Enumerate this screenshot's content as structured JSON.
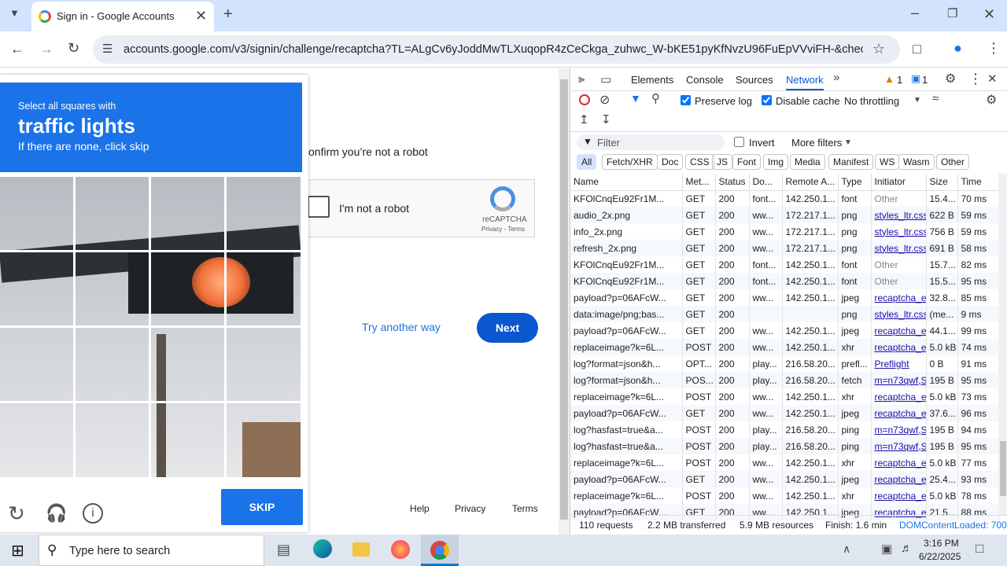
{
  "browser": {
    "tab_title": "Sign in - Google Accounts",
    "url": "accounts.google.com/v3/signin/challenge/recaptcha?TL=ALgCv6yJoddMwTLXuqopR4zCeCkga_zuhwc_W-bKE51pyKfNvzU96FuEpVVviFH-&checkConn..."
  },
  "page": {
    "confirm_text": "onfirm you’re not a robot",
    "not_robot_label": "I'm not a robot",
    "recaptcha_label": "reCAPTCHA",
    "recaptcha_links": "Privacy - Terms",
    "try_another": "Try another way",
    "next": "Next",
    "footer": {
      "help": "Help",
      "privacy": "Privacy",
      "terms": "Terms"
    }
  },
  "captcha": {
    "select_text": "Select all squares with",
    "target": "traffic lights",
    "hint": "If there are none, click skip",
    "skip": "SKIP"
  },
  "devtools": {
    "tabs": [
      "Elements",
      "Console",
      "Sources",
      "Network"
    ],
    "warnings": "1",
    "messages": "1",
    "preserve_log": "Preserve log",
    "disable_cache": "Disable cache",
    "throttling": "No throttling",
    "filter_placeholder": "Filter",
    "invert": "Invert",
    "more_filters": "More filters",
    "type_filters": [
      "All",
      "Fetch/XHR",
      "Doc",
      "CSS",
      "JS",
      "Font",
      "Img",
      "Media",
      "Manifest",
      "WS",
      "Wasm",
      "Other"
    ],
    "columns": [
      "Name",
      "Met...",
      "Status",
      "Do...",
      "Remote A...",
      "Type",
      "Initiator",
      "Size",
      "Time"
    ],
    "rows": [
      [
        "KFOlCnqEu92Fr1M...",
        "GET",
        "200",
        "font...",
        "142.250.1...",
        "font",
        "Other",
        "15.4...",
        "70 ms"
      ],
      [
        "audio_2x.png",
        "GET",
        "200",
        "ww...",
        "172.217.1...",
        "png",
        "styles_ltr.css",
        "622 B",
        "59 ms"
      ],
      [
        "info_2x.png",
        "GET",
        "200",
        "ww...",
        "172.217.1...",
        "png",
        "styles_ltr.css",
        "756 B",
        "59 ms"
      ],
      [
        "refresh_2x.png",
        "GET",
        "200",
        "ww...",
        "172.217.1...",
        "png",
        "styles_ltr.css",
        "691 B",
        "58 ms"
      ],
      [
        "KFOlCnqEu92Fr1M...",
        "GET",
        "200",
        "font...",
        "142.250.1...",
        "font",
        "Other",
        "15.7...",
        "82 ms"
      ],
      [
        "KFOlCnqEu92Fr1M...",
        "GET",
        "200",
        "font...",
        "142.250.1...",
        "font",
        "Other",
        "15.5...",
        "95 ms"
      ],
      [
        "payload?p=06AFcW...",
        "GET",
        "200",
        "ww...",
        "142.250.1...",
        "jpeg",
        "recaptcha_e",
        "32.8...",
        "85 ms"
      ],
      [
        "data:image/png;bas...",
        "GET",
        "200",
        "",
        "",
        "png",
        "styles_ltr.css",
        "(me...",
        "9 ms"
      ],
      [
        "payload?p=06AFcW...",
        "GET",
        "200",
        "ww...",
        "142.250.1...",
        "jpeg",
        "recaptcha_e",
        "44.1...",
        "99 ms"
      ],
      [
        "replaceimage?k=6L...",
        "POST",
        "200",
        "ww...",
        "142.250.1...",
        "xhr",
        "recaptcha_e",
        "5.0 kB",
        "74 ms"
      ],
      [
        "log?format=json&h...",
        "OPT...",
        "200",
        "play...",
        "216.58.20...",
        "prefl...",
        "Preflight",
        "0 B",
        "91 ms"
      ],
      [
        "log?format=json&h...",
        "POS...",
        "200",
        "play...",
        "216.58.20...",
        "fetch",
        "m=n73qwf,S",
        "195 B",
        "95 ms"
      ],
      [
        "replaceimage?k=6L...",
        "POST",
        "200",
        "ww...",
        "142.250.1...",
        "xhr",
        "recaptcha_e",
        "5.0 kB",
        "73 ms"
      ],
      [
        "payload?p=06AFcW...",
        "GET",
        "200",
        "ww...",
        "142.250.1...",
        "jpeg",
        "recaptcha_e",
        "37.6...",
        "96 ms"
      ],
      [
        "log?hasfast=true&a...",
        "POST",
        "200",
        "play...",
        "216.58.20...",
        "ping",
        "m=n73qwf,S",
        "195 B",
        "94 ms"
      ],
      [
        "log?hasfast=true&a...",
        "POST",
        "200",
        "play...",
        "216.58.20...",
        "ping",
        "m=n73qwf,S",
        "195 B",
        "95 ms"
      ],
      [
        "replaceimage?k=6L...",
        "POST",
        "200",
        "ww...",
        "142.250.1...",
        "xhr",
        "recaptcha_e",
        "5.0 kB",
        "77 ms"
      ],
      [
        "payload?p=06AFcW...",
        "GET",
        "200",
        "ww...",
        "142.250.1...",
        "jpeg",
        "recaptcha_e",
        "25.4...",
        "93 ms"
      ],
      [
        "replaceimage?k=6L...",
        "POST",
        "200",
        "ww...",
        "142.250.1...",
        "xhr",
        "recaptcha_e",
        "5.0 kB",
        "78 ms"
      ],
      [
        "payload?p=06AFcW...",
        "GET",
        "200",
        "ww...",
        "142.250.1...",
        "jpeg",
        "recaptcha_e",
        "21.5...",
        "88 ms"
      ]
    ],
    "status": {
      "requests": "110 requests",
      "transferred": "2.2 MB transferred",
      "resources": "5.9 MB resources",
      "finish": "Finish: 1.6 min",
      "dcl": "DOMContentLoaded: 700"
    }
  },
  "taskbar": {
    "search_placeholder": "Type here to search",
    "time": "3:16 PM",
    "date": "6/22/2025"
  }
}
